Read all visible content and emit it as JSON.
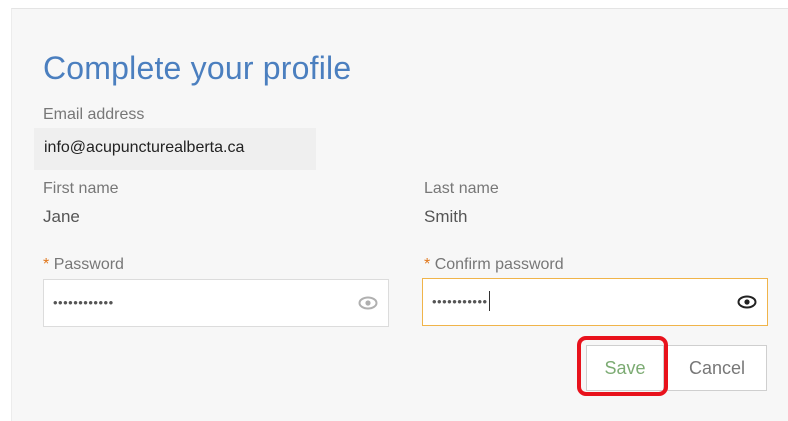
{
  "form": {
    "title": "Complete your profile",
    "email_label": "Email address",
    "email_value": "info@acupuncturealberta.ca",
    "first_name_label": "First name",
    "first_name_value": "Jane",
    "last_name_label": "Last name",
    "last_name_value": "Smith",
    "required_marker": "*",
    "password_label": "Password",
    "password_value": "••••••••••••",
    "confirm_password_label": "Confirm password",
    "confirm_password_value": "•••••••••••",
    "show_password_icon": "eye-icon",
    "save_label": "Save",
    "cancel_label": "Cancel"
  },
  "colors": {
    "title": "#4b7fbf",
    "required": "#e0761a",
    "focus_border": "#f0b44a",
    "save_text": "#7cab73",
    "highlight": "#e8121c"
  }
}
